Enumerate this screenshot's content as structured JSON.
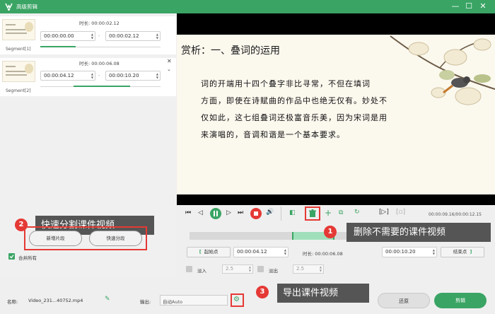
{
  "window": {
    "title": "高级剪辑",
    "min": "—",
    "max": "☐",
    "close": "✕"
  },
  "segments": [
    {
      "label": "Segment[1]",
      "duration_label": "时长: 00:00:02.12",
      "start": "00:00:00.00",
      "end": "00:00:02.12"
    },
    {
      "label": "Segment[2]",
      "duration_label": "时长: 00:00:06.08",
      "start": "00:00:04.12",
      "end": "00:00:10.20"
    }
  ],
  "buttons": {
    "add_segment": "新增片段",
    "quick_split": "快速分段",
    "merge_all": "合并所有",
    "reset": "还原",
    "export": "剪辑"
  },
  "annotations": {
    "one": {
      "num": "1",
      "text": "删除不需要的课件视频"
    },
    "two": {
      "num": "2",
      "text": "快速分割课件视频"
    },
    "three": {
      "num": "3",
      "text": "导出课件视频"
    }
  },
  "slide": {
    "heading": "赏析：一、叠词的运用",
    "lines": [
      "词的开端用十四个叠字非比寻常，不但在填词",
      "方面，即使在诗赋曲的作品中也绝无仅有。妙处不",
      "仅如此，这七组叠词还极富音乐美，因为宋词是用",
      "来演唱的，音调和谐是一个基本要求。"
    ]
  },
  "player": {
    "time": "00:00:09.16/00:00:12.15",
    "start_btn": "起始点",
    "start_time": "00:00:04.12",
    "duration": "时长: 00:00:06.08",
    "end_time": "00:00:10.20",
    "end_btn": "结束点",
    "fade_in_label": "淡入",
    "fade_in": "2.5",
    "fade_out_label": "淡出",
    "fade_out": "2.5"
  },
  "footer": {
    "name_label": "名称:",
    "name_value": "Video_231...40752.mp4",
    "output_label": "输出:",
    "output_value": "自动Auto"
  },
  "colors": {
    "brand": "#3aa464",
    "highlight": "#e53935",
    "callout": "#555555"
  }
}
